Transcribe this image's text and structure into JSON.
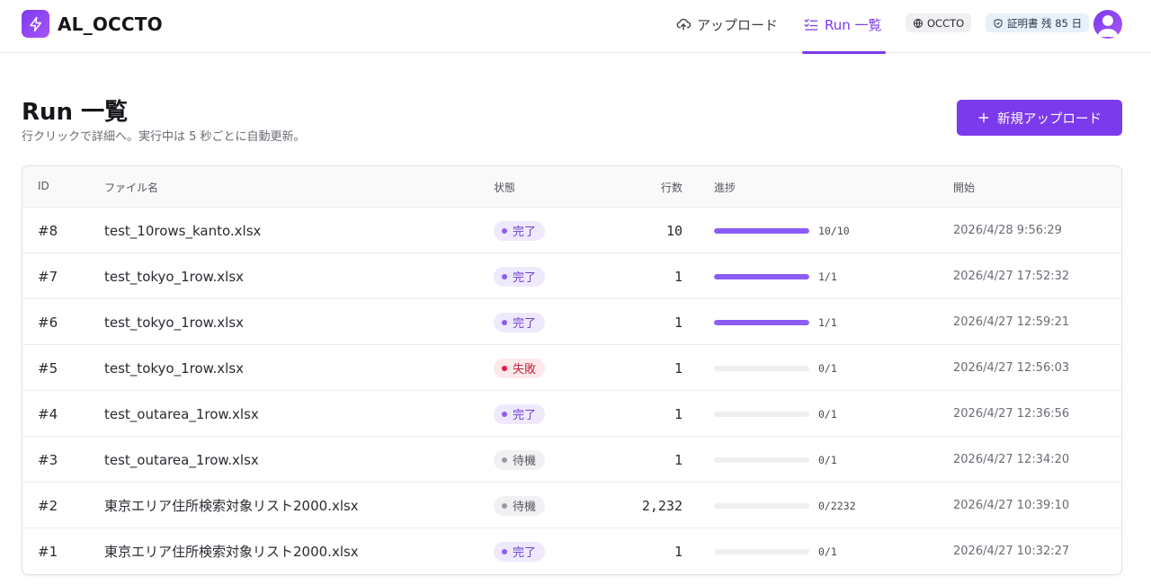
{
  "app": {
    "title": "AL_OCCTO"
  },
  "nav": {
    "upload_label": "アップロード",
    "runs_label": "Run 一覧",
    "occto_label": "OCCTO",
    "cert_label": "証明書 残 85 日"
  },
  "page": {
    "title": "Run 一覧",
    "subtitle": "行クリックで詳細へ。実行中は 5 秒ごとに自動更新。",
    "new_upload_label": "新規アップロード"
  },
  "colors": {
    "accent": "#7c3aed",
    "progress": "#8b5cf6"
  },
  "table": {
    "headers": {
      "id": "ID",
      "file": "ファイル名",
      "status": "状態",
      "rows": "行数",
      "progress": "進捗",
      "start": "開始"
    },
    "rows": [
      {
        "id": "#8",
        "file": "test_10rows_kanto.xlsx",
        "status": "完了",
        "status_type": "done",
        "rows": "10",
        "progress_text": "10/10",
        "progress": 1.0,
        "start": "2026/4/28 9:56:29"
      },
      {
        "id": "#7",
        "file": "test_tokyo_1row.xlsx",
        "status": "完了",
        "status_type": "done",
        "rows": "1",
        "progress_text": "1/1",
        "progress": 1.0,
        "start": "2026/4/27 17:52:32"
      },
      {
        "id": "#6",
        "file": "test_tokyo_1row.xlsx",
        "status": "完了",
        "status_type": "done",
        "rows": "1",
        "progress_text": "1/1",
        "progress": 1.0,
        "start": "2026/4/27 12:59:21"
      },
      {
        "id": "#5",
        "file": "test_tokyo_1row.xlsx",
        "status": "失敗",
        "status_type": "failed",
        "rows": "1",
        "progress_text": "0/1",
        "progress": 0,
        "start": "2026/4/27 12:56:03"
      },
      {
        "id": "#4",
        "file": "test_outarea_1row.xlsx",
        "status": "完了",
        "status_type": "done",
        "rows": "1",
        "progress_text": "0/1",
        "progress": 0,
        "start": "2026/4/27 12:36:56"
      },
      {
        "id": "#3",
        "file": "test_outarea_1row.xlsx",
        "status": "待機",
        "status_type": "waiting",
        "rows": "1",
        "progress_text": "0/1",
        "progress": 0,
        "start": "2026/4/27 12:34:20"
      },
      {
        "id": "#2",
        "file": "東京エリア住所検索対象リスト2000.xlsx",
        "status": "待機",
        "status_type": "waiting",
        "rows": "2,232",
        "progress_text": "0/2232",
        "progress": 0,
        "start": "2026/4/27 10:39:10"
      },
      {
        "id": "#1",
        "file": "東京エリア住所検索対象リスト2000.xlsx",
        "status": "完了",
        "status_type": "done",
        "rows": "1",
        "progress_text": "0/1",
        "progress": 0,
        "start": "2026/4/27 10:32:27"
      }
    ]
  }
}
